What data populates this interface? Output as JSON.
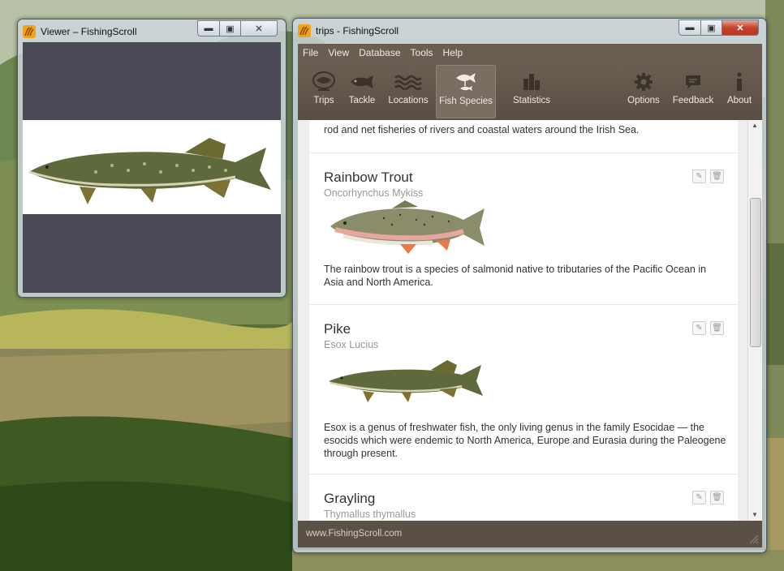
{
  "viewer": {
    "title": "Viewer – FishingScroll"
  },
  "main": {
    "title": "trips - FishingScroll",
    "menu": [
      "File",
      "View",
      "Database",
      "Tools",
      "Help"
    ],
    "toolbar": {
      "trips": "Trips",
      "tackle": "Tackle",
      "locations": "Locations",
      "fish_species": "Fish Species",
      "statistics": "Statistics",
      "options": "Options",
      "feedback": "Feedback",
      "about": "About"
    },
    "entries": {
      "partial_desc": "rod and net fisheries of rivers and coastal waters around the Irish Sea.",
      "rainbow": {
        "title": "Rainbow Trout",
        "sci": "Oncorhynchus Mykiss",
        "desc": "The rainbow trout is a species of salmonid native to tributaries of the Pacific Ocean in Asia and North America."
      },
      "pike": {
        "title": "Pike",
        "sci": "Esox Lucius",
        "desc": "Esox is a genus of freshwater fish, the only living genus in the family Esocidae — the esocids which were endemic to North America, Europe and Eurasia during the Paleogene through present."
      },
      "grayling": {
        "title": "Grayling",
        "sci": "Thymallus thymallus"
      }
    },
    "footer": "www.FishingScroll.com"
  },
  "colors": {
    "toolbar": "#5f5348",
    "menubar": "#6a5e52",
    "footer": "#5a5046",
    "viewer_bg": "#4a4a56"
  }
}
